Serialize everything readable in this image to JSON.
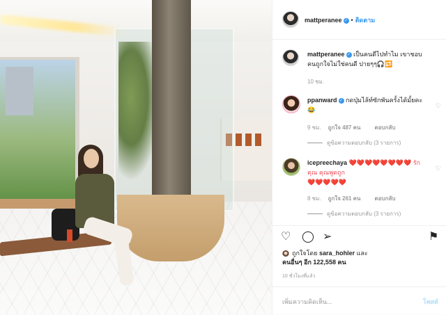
{
  "header": {
    "username": "mattperanee",
    "follow_label": "ติดตาม"
  },
  "caption": {
    "username": "mattperanee",
    "text": "เป็นคนดีไปทำไม เขาชอบคนถูกใจไม่ใช่คนดี ปายๆๆ🎧🔁",
    "time": "10 ชม."
  },
  "comments": [
    {
      "username": "ppanward",
      "text": "กดปุ่มไล้ท์ซักพันครั้งได้มั้ยคะ😂",
      "time": "9 ชม.",
      "likes": "ถูกใจ 487 คน",
      "reply_label": "ตอบกลับ",
      "view_replies": "ดูข้อความตอบกลับ (3 รายการ)"
    },
    {
      "username": "icepreechaya",
      "text_a": "❤️❤️❤️❤️❤️❤️❤️❤️ รักคุณ คุณพูดถูก",
      "text_b": "❤️❤️❤️❤️❤️",
      "time": "8 ชม.",
      "likes": "ถูกใจ 261 คน",
      "reply_label": "ตอบกลับ",
      "view_replies": "ดูข้อความตอบกลับ (3 รายการ)"
    }
  ],
  "likes": {
    "prefix": "ถูกใจโดย",
    "user": "sara_hohler",
    "and": "และ",
    "others": "คนอื่นๆ อีก 122,558 คน"
  },
  "time_ago": "10 ชั่วโมงที่แล้ว",
  "compose": {
    "placeholder": "เพิ่มความคิดเห็น...",
    "post_label": "โพสต์"
  },
  "icons": [
    "heart-icon",
    "comment-icon",
    "share-icon",
    "bookmark-icon"
  ],
  "colors": {
    "link": "#3897f0",
    "muted": "#999999",
    "heart": "#ed4956"
  }
}
